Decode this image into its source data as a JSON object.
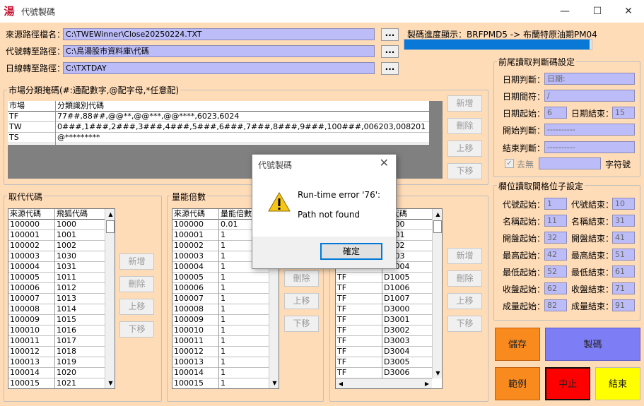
{
  "window": {
    "title": "代號製碼",
    "app_icon_glyph": "湯",
    "controls": {
      "minimize": "—",
      "maximize": "☐",
      "close": "✕"
    }
  },
  "paths": {
    "source_label": "來源路徑檔名：",
    "source_value": "C:\\TWEWinner\\Close20250224.TXT",
    "code_label": "代號轉至路徑：",
    "code_value": "C:\\鳥湯股市資料庫\\代碼",
    "daily_label": "日線轉至路徑：",
    "daily_value": "C:\\TXTDAY",
    "browse_label": "..."
  },
  "progress": {
    "label": "製碼進度顯示：BRFPMD5 -> 布蘭特原油期PM04",
    "value_fraction": 0.99
  },
  "market": {
    "title": "市場分類掩碼(#:通配數字,@配字母,*任意配)",
    "headers": [
      "市場",
      "分類識別代碼"
    ],
    "rows": [
      [
        "TF",
        "77##,88##,@@**,@@***,@@****,6023,6024"
      ],
      [
        "TW",
        "0###,1###,2###,3###,4###,5###,6###,7###,8###,9###,100###,006203,008201"
      ],
      [
        "TS",
        "@*********"
      ]
    ],
    "buttons": [
      "新增",
      "刪除",
      "上移",
      "下移"
    ]
  },
  "replace": {
    "title": "取代代碼",
    "headers": [
      "來源代碼",
      "飛狐代碼"
    ],
    "rows": [
      [
        "100000",
        "1000"
      ],
      [
        "100001",
        "1001"
      ],
      [
        "100002",
        "1002"
      ],
      [
        "100003",
        "1030"
      ],
      [
        "100004",
        "1031"
      ],
      [
        "100005",
        "1011"
      ],
      [
        "100006",
        "1012"
      ],
      [
        "100007",
        "1013"
      ],
      [
        "100008",
        "1014"
      ],
      [
        "100009",
        "1015"
      ],
      [
        "100010",
        "1016"
      ],
      [
        "100011",
        "1017"
      ],
      [
        "100012",
        "1018"
      ],
      [
        "100013",
        "1019"
      ],
      [
        "100014",
        "1020"
      ],
      [
        "100015",
        "1021"
      ]
    ],
    "buttons": [
      "新增",
      "刪除",
      "上移",
      "下移"
    ]
  },
  "volume": {
    "title": "量能倍數",
    "headers": [
      "來源代碼",
      "量能倍數"
    ],
    "rows": [
      [
        "100000",
        "0.01"
      ],
      [
        "100001",
        "1"
      ],
      [
        "100002",
        "1"
      ],
      [
        "100003",
        "1"
      ],
      [
        "100004",
        "1"
      ],
      [
        "100005",
        "1"
      ],
      [
        "100006",
        "1"
      ],
      [
        "100007",
        "1"
      ],
      [
        "100008",
        "1"
      ],
      [
        "100009",
        "1"
      ],
      [
        "100010",
        "1"
      ],
      [
        "100011",
        "1"
      ],
      [
        "100012",
        "1"
      ],
      [
        "100013",
        "1"
      ],
      [
        "100014",
        "1"
      ],
      [
        "100015",
        "1"
      ]
    ],
    "buttons": [
      "刪除",
      "上移",
      "下移"
    ]
  },
  "third": {
    "header_partial": "票代碼",
    "rows": [
      [
        "",
        "D000"
      ],
      [
        "",
        "D001"
      ],
      [
        "",
        "D002"
      ],
      [
        "",
        "D003"
      ],
      [
        "TF",
        "D1004"
      ],
      [
        "TF",
        "D1005"
      ],
      [
        "TF",
        "D1006"
      ],
      [
        "TF",
        "D1007"
      ],
      [
        "TF",
        "D3000"
      ],
      [
        "TF",
        "D3001"
      ],
      [
        "TF",
        "D3002"
      ],
      [
        "TF",
        "D3003"
      ],
      [
        "TF",
        "D3004"
      ],
      [
        "TF",
        "D3005"
      ],
      [
        "TF",
        "D3006"
      ]
    ],
    "buttons": [
      "新增",
      "刪除",
      "上移",
      "下移"
    ]
  },
  "head_tail": {
    "title": "前尾讀取判斷碼設定",
    "date_check_label": "日期判斷：",
    "date_check_value": "日期:",
    "date_sep_label": "日期間符：",
    "date_sep_value": "/",
    "date_start_label": "日期起始：",
    "date_start_value": "6",
    "date_end_label": "日期結束：",
    "date_end_value": "15",
    "open_check_label": "開始判斷：",
    "open_check_value": "----------",
    "end_check_label": "結束判斷：",
    "end_check_value": "----------",
    "remove_label": "去無",
    "char_label": "字符號"
  },
  "columns": {
    "title": "欄位讀取間格位子設定",
    "items": [
      {
        "start_label": "代號起始：",
        "start": "1",
        "end_label": "代號結束：",
        "end": "10"
      },
      {
        "start_label": "名稱起始：",
        "start": "11",
        "end_label": "名稱結束：",
        "end": "31"
      },
      {
        "start_label": "開盤起始：",
        "start": "32",
        "end_label": "開盤結束：",
        "end": "41"
      },
      {
        "start_label": "最高起始：",
        "start": "42",
        "end_label": "最高結束：",
        "end": "51"
      },
      {
        "start_label": "最低起始：",
        "start": "52",
        "end_label": "最低結束：",
        "end": "61"
      },
      {
        "start_label": "收盤起始：",
        "start": "62",
        "end_label": "收盤結束：",
        "end": "71"
      },
      {
        "start_label": "成量起始：",
        "start": "82",
        "end_label": "成量結束：",
        "end": "91"
      }
    ]
  },
  "actions": {
    "save": "儲存",
    "make": "製碼",
    "example": "範例",
    "stop": "中止",
    "exit": "結束",
    "colors": {
      "save": "#f98a1e",
      "make": "#7d7df6",
      "example": "#f98a1e",
      "stop": "#ff0000",
      "exit": "#ffff00"
    }
  },
  "dialog": {
    "title": "代號製碼",
    "close": "✕",
    "line1": "Run-time error '76':",
    "line2": "Path not found",
    "ok": "確定",
    "icon": "warning-icon"
  }
}
